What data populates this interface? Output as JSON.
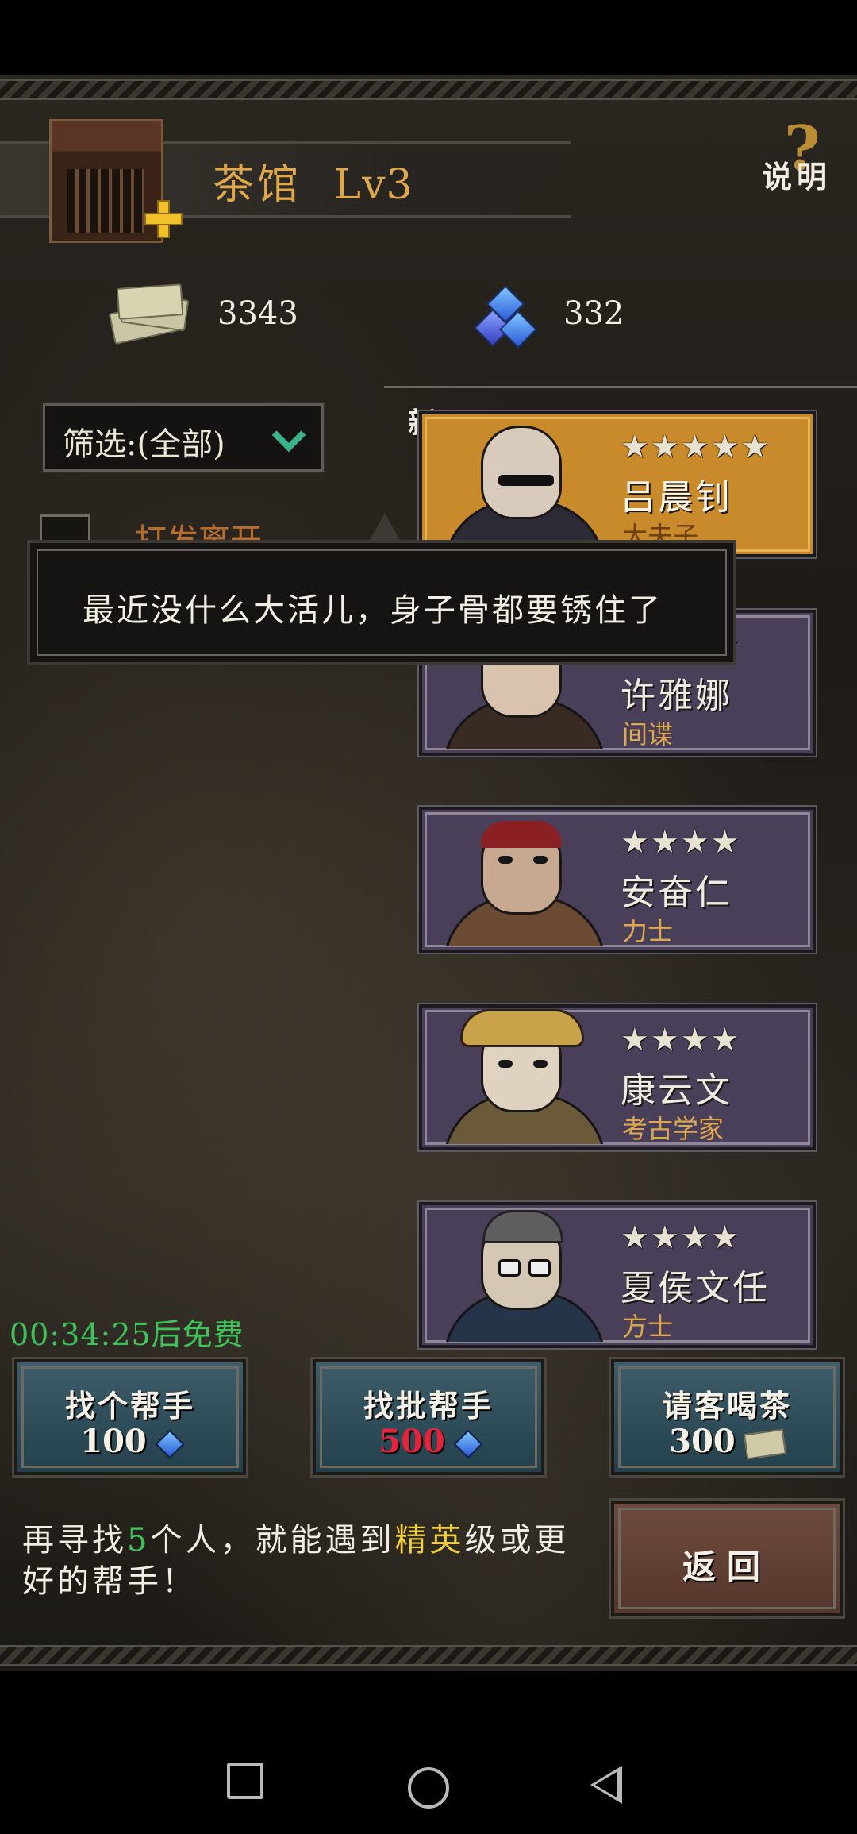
{
  "header": {
    "title": "茶馆",
    "level": "Lv3",
    "help_label": "说明"
  },
  "currency": {
    "money": "3343",
    "gems": "332"
  },
  "filter": {
    "label": "筛选:(全部)"
  },
  "hidden_label": "打发离开",
  "new_badge": "新",
  "dialog": {
    "text": "最近没什么大活儿，身子骨都要锈住了"
  },
  "heroes": [
    {
      "name": "吕晨钊",
      "class": "大夫子",
      "stars": "★★★★★",
      "highlight": true
    },
    {
      "name": "许雅娜",
      "class": "间谍",
      "stars": "★★★★",
      "highlight": false
    },
    {
      "name": "安奋仁",
      "class": "力士",
      "stars": "★★★★",
      "highlight": false
    },
    {
      "name": "康云文",
      "class": "考古学家",
      "stars": "★★★★",
      "highlight": false
    },
    {
      "name": "夏侯文任",
      "class": "方士",
      "stars": "★★★★",
      "highlight": false
    }
  ],
  "timer": "00:34:25后免费",
  "buttons": {
    "find_one": {
      "label": "找个帮手",
      "cost": "100",
      "currency_icon": "gem-icon"
    },
    "find_batch": {
      "label": "找批帮手",
      "cost": "500",
      "currency_icon": "gem-icon"
    },
    "treat_tea": {
      "label": "请客喝茶",
      "cost": "300",
      "currency_icon": "cash-icon"
    },
    "back": {
      "label": "返回"
    }
  },
  "hint": {
    "part1": "再寻找",
    "count": "5",
    "part2": "个人，就能遇到",
    "rank": "精英",
    "part3": "级或更好的帮手！"
  },
  "colors": {
    "accent_gold": "#e0a84c",
    "timer_green": "#3ec35a",
    "cost_red": "#e6233a",
    "card_purple": "#4a3f58",
    "card_gold": "#c88a2b"
  }
}
